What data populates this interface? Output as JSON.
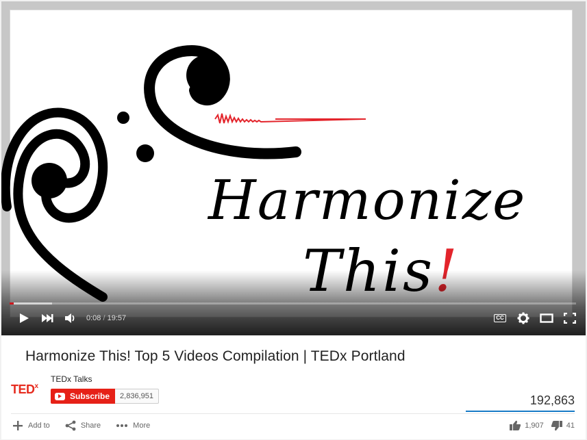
{
  "video": {
    "thumbnail_text_line1": "Harmonize",
    "thumbnail_text_line2": "This",
    "thumbnail_text_exclaim": "!",
    "current_time": "0:08",
    "separator": " / ",
    "duration": "19:57",
    "progress_fraction": 0.007,
    "buffered_fraction": 0.075,
    "cc_label": "CC"
  },
  "info": {
    "title": "Harmonize This! Top 5 Videos Compilation | TEDx Portland",
    "channel_logo": "TED",
    "channel_logo_sup": "x",
    "channel_name": "TEDx Talks",
    "subscribe_label": "Subscribe",
    "subscriber_count": "2,836,951",
    "view_count": "192,863",
    "add_to_label": "Add to",
    "share_label": "Share",
    "more_label": "More",
    "like_count": "1,907",
    "dislike_count": "41"
  },
  "colors": {
    "accent_red": "#e62117",
    "view_bar_blue": "#167ac6",
    "thumbnail_exclaim": "#e3242b"
  },
  "icons": [
    "play-icon",
    "next-icon",
    "volume-icon",
    "cc-icon",
    "settings-icon",
    "theater-icon",
    "fullscreen-icon",
    "add-icon",
    "share-icon",
    "more-icon",
    "thumbs-up-icon",
    "thumbs-down-icon"
  ]
}
